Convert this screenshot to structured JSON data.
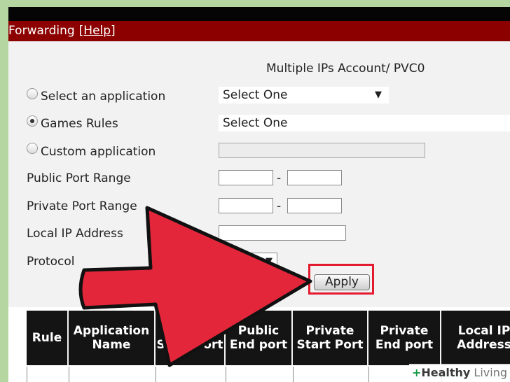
{
  "header": {
    "title": "Forwarding",
    "help_link": "[Help]"
  },
  "account": "Multiple IPs Account/ PVC0",
  "form": {
    "radio_select_application": "Select an application",
    "radio_games_rules": "Games Rules",
    "radio_custom_application": "Custom application",
    "application_select_value": "Select One",
    "games_select_value": "Select One",
    "public_port_range_label": "Public Port Range",
    "private_port_range_label": "Private Port Range",
    "local_ip_label": "Local IP Address",
    "protocol_label": "Protocol",
    "range_separator": "-",
    "apply_label": "Apply",
    "selected_radio": "games_rules"
  },
  "table": {
    "headers": [
      "Rule",
      "Application Name",
      "Public Start Port",
      "Public End port",
      "Private Start Port",
      "Private End port",
      "Local IP Address"
    ]
  },
  "watermark": {
    "plus": "+",
    "brand": "Healthy",
    "suffix": " Living"
  },
  "colors": {
    "title_bar": "#8c0000",
    "highlight": "#e21b2f",
    "arrow": "#e4263b",
    "background": "#b5d6a0"
  },
  "icons": [
    "radio-icon",
    "dropdown-arrow-icon",
    "pointer-arrow-icon",
    "healthy-living-logo-icon"
  ]
}
